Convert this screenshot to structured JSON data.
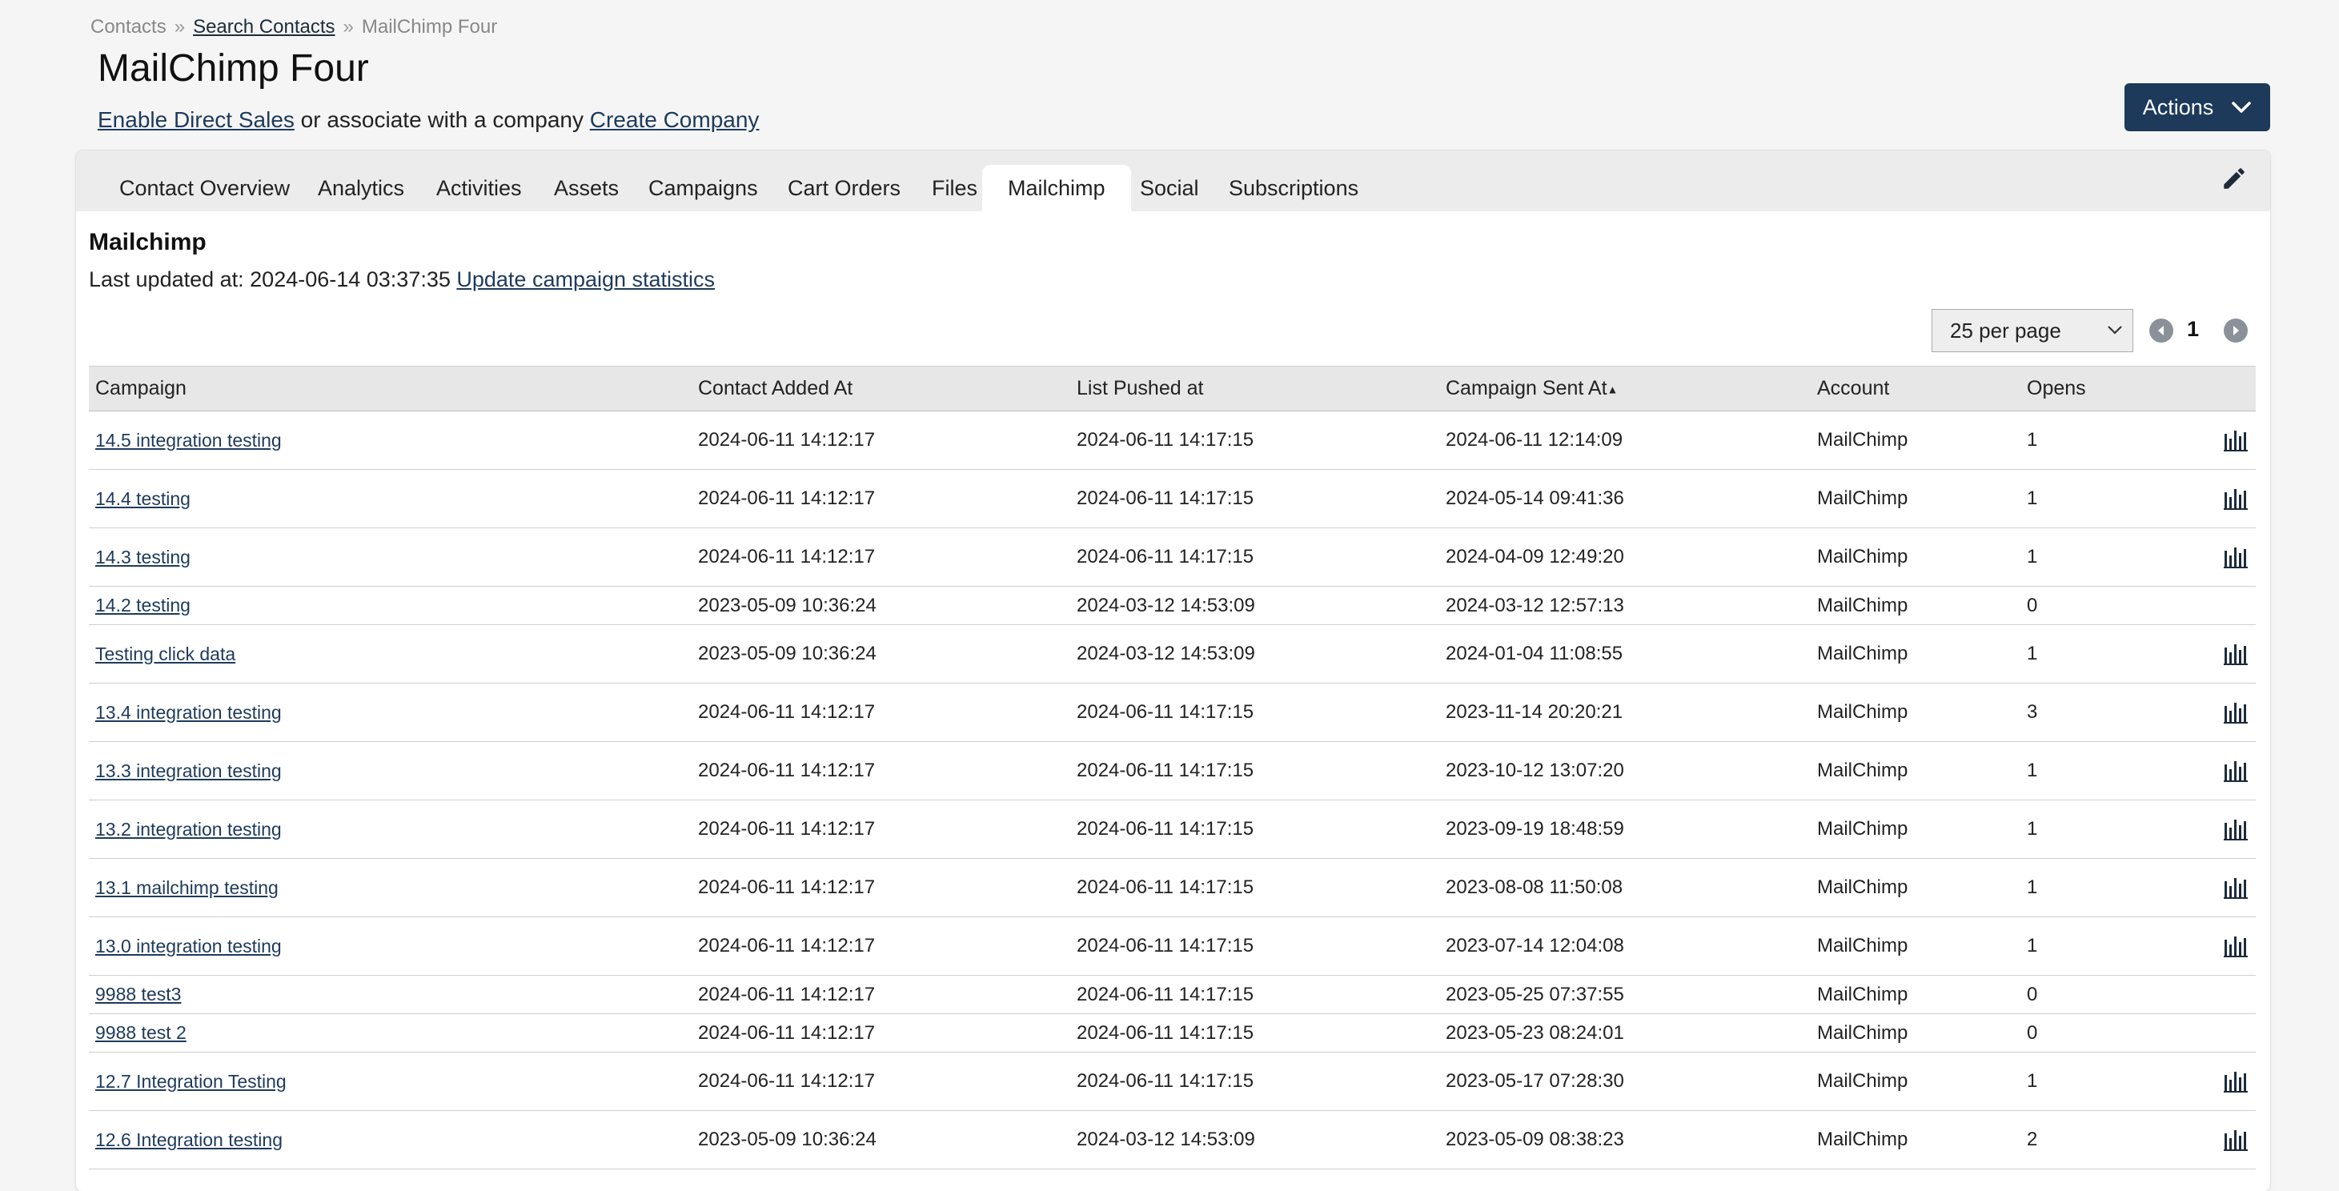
{
  "breadcrumb": {
    "root": "Contacts",
    "sep": "»",
    "search": "Search Contacts",
    "current": "MailChimp Four"
  },
  "page_title": "MailChimp Four",
  "subline": {
    "enable_direct_sales": "Enable Direct Sales",
    "middle": " or associate with a company ",
    "create_company": "Create Company"
  },
  "actions_label": "Actions",
  "tabs": [
    "Contact Overview",
    "Analytics",
    "Activities",
    "Assets",
    "Campaigns",
    "Cart Orders",
    "Files",
    "Mailchimp",
    "Social",
    "Subscriptions"
  ],
  "active_tab": "Mailchimp",
  "section_title": "Mailchimp",
  "updated": {
    "prefix": "Last updated at: 2024-06-14 03:37:35 ",
    "link": "Update campaign statistics"
  },
  "pagination": {
    "per_page": "25 per page",
    "page": "1"
  },
  "table": {
    "headers": [
      "Campaign",
      "Contact Added At",
      "List Pushed at",
      "Campaign Sent At",
      "Account",
      "Opens"
    ],
    "sort_indicator": "▲",
    "rows": [
      {
        "campaign": "14.5 integration testing",
        "added": "2024-06-11 14:12:17",
        "pushed": "2024-06-11 14:17:15",
        "sent": "2024-06-11 12:14:09",
        "account": "MailChimp",
        "opens": "1",
        "stats": true
      },
      {
        "campaign": "14.4 testing",
        "added": "2024-06-11 14:12:17",
        "pushed": "2024-06-11 14:17:15",
        "sent": "2024-05-14 09:41:36",
        "account": "MailChimp",
        "opens": "1",
        "stats": true
      },
      {
        "campaign": "14.3 testing",
        "added": "2024-06-11 14:12:17",
        "pushed": "2024-06-11 14:17:15",
        "sent": "2024-04-09 12:49:20",
        "account": "MailChimp",
        "opens": "1",
        "stats": true
      },
      {
        "campaign": "14.2 testing",
        "added": "2023-05-09 10:36:24",
        "pushed": "2024-03-12 14:53:09",
        "sent": "2024-03-12 12:57:13",
        "account": "MailChimp",
        "opens": "0",
        "stats": false
      },
      {
        "campaign": "Testing click data",
        "added": "2023-05-09 10:36:24",
        "pushed": "2024-03-12 14:53:09",
        "sent": "2024-01-04 11:08:55",
        "account": "MailChimp",
        "opens": "1",
        "stats": true
      },
      {
        "campaign": "13.4 integration testing",
        "added": "2024-06-11 14:12:17",
        "pushed": "2024-06-11 14:17:15",
        "sent": "2023-11-14 20:20:21",
        "account": "MailChimp",
        "opens": "3",
        "stats": true
      },
      {
        "campaign": "13.3 integration testing",
        "added": "2024-06-11 14:12:17",
        "pushed": "2024-06-11 14:17:15",
        "sent": "2023-10-12 13:07:20",
        "account": "MailChimp",
        "opens": "1",
        "stats": true
      },
      {
        "campaign": "13.2 integration testing",
        "added": "2024-06-11 14:12:17",
        "pushed": "2024-06-11 14:17:15",
        "sent": "2023-09-19 18:48:59",
        "account": "MailChimp",
        "opens": "1",
        "stats": true
      },
      {
        "campaign": "13.1 mailchimp testing",
        "added": "2024-06-11 14:12:17",
        "pushed": "2024-06-11 14:17:15",
        "sent": "2023-08-08 11:50:08",
        "account": "MailChimp",
        "opens": "1",
        "stats": true
      },
      {
        "campaign": "13.0 integration testing",
        "added": "2024-06-11 14:12:17",
        "pushed": "2024-06-11 14:17:15",
        "sent": "2023-07-14 12:04:08",
        "account": "MailChimp",
        "opens": "1",
        "stats": true
      },
      {
        "campaign": "9988 test3",
        "added": "2024-06-11 14:12:17",
        "pushed": "2024-06-11 14:17:15",
        "sent": "2023-05-25 07:37:55",
        "account": "MailChimp",
        "opens": "0",
        "stats": false
      },
      {
        "campaign": "9988 test 2",
        "added": "2024-06-11 14:12:17",
        "pushed": "2024-06-11 14:17:15",
        "sent": "2023-05-23 08:24:01",
        "account": "MailChimp",
        "opens": "0",
        "stats": false
      },
      {
        "campaign": "12.7 Integration Testing",
        "added": "2024-06-11 14:12:17",
        "pushed": "2024-06-11 14:17:15",
        "sent": "2023-05-17 07:28:30",
        "account": "MailChimp",
        "opens": "1",
        "stats": true
      },
      {
        "campaign": "12.6 Integration testing",
        "added": "2023-05-09 10:36:24",
        "pushed": "2024-03-12 14:53:09",
        "sent": "2023-05-09 08:38:23",
        "account": "MailChimp",
        "opens": "2",
        "stats": true
      }
    ]
  },
  "colors": {
    "actions_bg": "#1d3a5a",
    "link": "#1d3a5c",
    "tabbar_bg": "#ececec"
  },
  "icons": {
    "actions": "chevron-down-icon",
    "edit": "pencil-icon",
    "prev": "chevron-left-icon",
    "next": "chevron-right-icon",
    "stats": "bar-chart-icon"
  }
}
